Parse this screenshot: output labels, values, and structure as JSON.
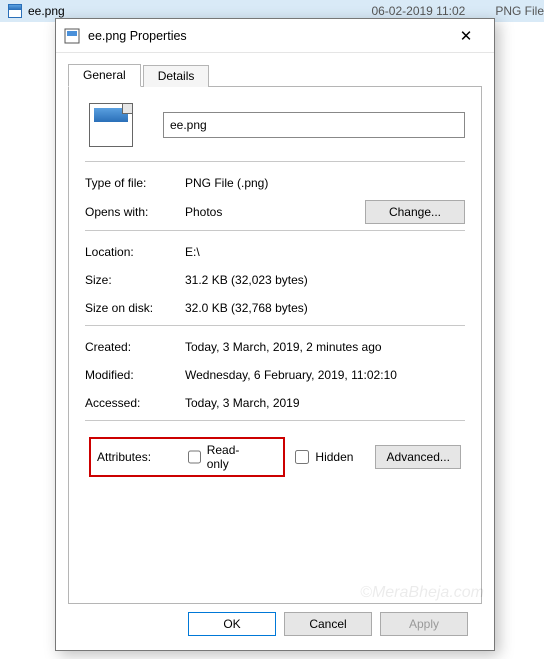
{
  "background_row": {
    "filename": "ee.png",
    "date": "06-02-2019 11:02",
    "type": "PNG File"
  },
  "dialog": {
    "title": "ee.png Properties",
    "tabs": {
      "general": "General",
      "details": "Details"
    },
    "filename_value": "ee.png",
    "fields": {
      "type_label": "Type of file:",
      "type_value": "PNG File (.png)",
      "opens_label": "Opens with:",
      "opens_value": "Photos",
      "change_btn": "Change...",
      "location_label": "Location:",
      "location_value": "E:\\",
      "size_label": "Size:",
      "size_value": "31.2 KB (32,023 bytes)",
      "sizeod_label": "Size on disk:",
      "sizeod_value": "32.0 KB (32,768 bytes)",
      "created_label": "Created:",
      "created_value": "Today, 3 March, 2019, 2 minutes ago",
      "modified_label": "Modified:",
      "modified_value": "Wednesday, 6 February, 2019, 11:02:10",
      "accessed_label": "Accessed:",
      "accessed_value": "Today, 3 March, 2019",
      "attrs_label": "Attributes:",
      "readonly_label": "Read-only",
      "hidden_label": "Hidden",
      "advanced_btn": "Advanced..."
    },
    "buttons": {
      "ok": "OK",
      "cancel": "Cancel",
      "apply": "Apply"
    }
  }
}
